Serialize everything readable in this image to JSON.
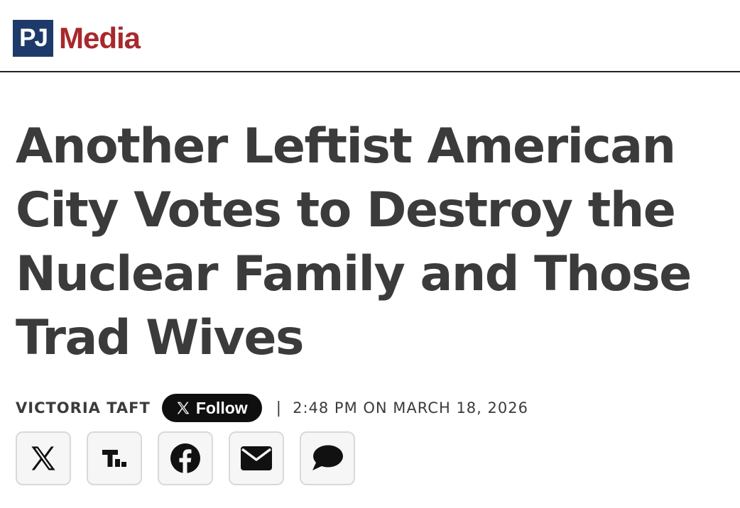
{
  "header": {
    "logo_box": "PJ",
    "logo_word": "Media",
    "colors": {
      "logo_box_bg": "#1e3a6a",
      "logo_word": "#a8282c"
    }
  },
  "article": {
    "headline": "Another Leftist American City Votes to Destroy the Nuclear Family and Those Trad Wives",
    "author": "VICTORIA TAFT",
    "follow_label": "Follow",
    "separator": "|",
    "timestamp": "2:48 PM ON MARCH 18, 2026"
  },
  "share_buttons": [
    {
      "icon": "x-icon"
    },
    {
      "icon": "truth-social-icon"
    },
    {
      "icon": "facebook-icon"
    },
    {
      "icon": "email-icon"
    },
    {
      "icon": "comment-icon"
    }
  ]
}
